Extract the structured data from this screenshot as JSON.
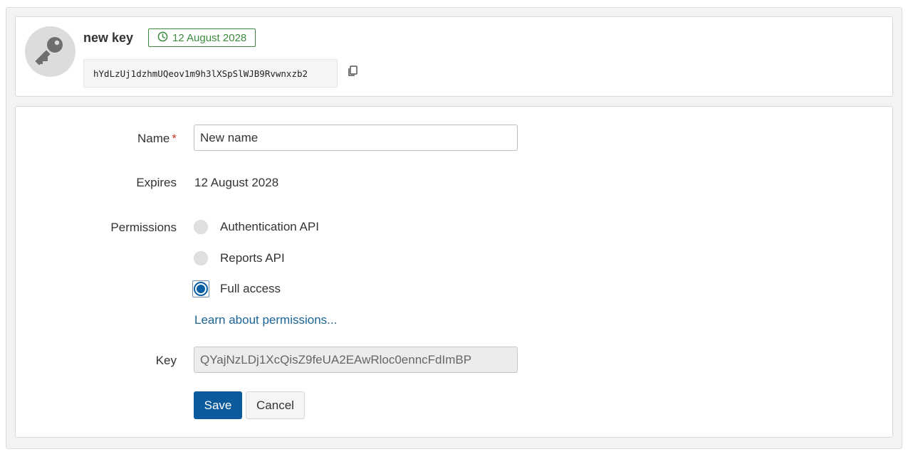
{
  "key_card": {
    "title": "new key",
    "expiry_badge": "12 August 2028",
    "token": "hYdLzUj1dzhmUQeov1m9h3lXSpSlWJB9Rvwnxzb2",
    "avatar_icon": "key-icon",
    "badge_icon": "clock-icon",
    "copy_icon": "copy-icon"
  },
  "form": {
    "name_label": "Name",
    "required_mark": "*",
    "name_value": "New name",
    "expires_label": "Expires",
    "expires_value": "12 August 2028",
    "permissions_label": "Permissions",
    "permissions": [
      {
        "label": "Authentication API",
        "checked": false
      },
      {
        "label": "Reports API",
        "checked": false
      },
      {
        "label": "Full access",
        "checked": true
      }
    ],
    "learn_link": "Learn about permissions...",
    "key_label": "Key",
    "key_value": "QYajNzLDj1XcQisZ9feUA2EAwRloc0enncFdImBP",
    "save_label": "Save",
    "cancel_label": "Cancel"
  },
  "colors": {
    "accent": "#0a5a9c",
    "badge_green": "#3b8a3e",
    "link": "#1a6496",
    "required": "#c0392b"
  }
}
